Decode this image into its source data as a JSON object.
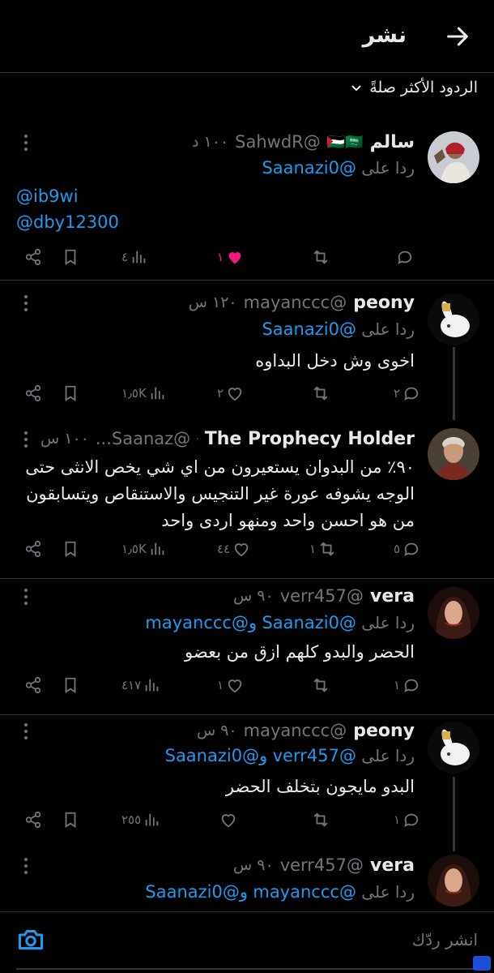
{
  "header": {
    "title": "نشر"
  },
  "sort": {
    "label": "الردود الأكثر صلةً"
  },
  "tweets": [
    {
      "name": "سالم",
      "flags": "🇵🇸🇸🇦",
      "handle": "@SahwdR",
      "time": "١٠٠ د",
      "reply_prefix": "ردا على",
      "reply_to": "@Saanazi0",
      "extra_mentions": [
        "@ib9wi",
        "@dby12300"
      ],
      "text": "",
      "counts": {
        "views": "٤",
        "like": "١",
        "retweet": "",
        "reply": ""
      }
    },
    {
      "name": "peony",
      "handle": "@mayanccc",
      "time": "١٢٠ س",
      "reply_prefix": "ردا على",
      "reply_to": "@Saanazi0",
      "text": "اخوى وش دخل البداوه",
      "counts": {
        "views": "١٫٥K",
        "like": "٢",
        "retweet": "",
        "reply": "٢"
      }
    },
    {
      "name": "The Prophecy Holder",
      "handle": "@Saanaz...",
      "time": "١٠٠ س",
      "text": "٩٠٪ من البدوان يستعيرون من اي شي يخص الانثى حتى الوجه يشوفه عورة غير التنجيس والاستنقاص ويتسابقون من هو احسن واحد ومنهو اردى واحد",
      "counts": {
        "views": "١٫٥K",
        "like": "٤٤",
        "retweet": "١",
        "reply": "٥"
      }
    },
    {
      "name": "vera",
      "handle": "@verr457",
      "time": "٩٠ س",
      "reply_prefix": "ردا على",
      "reply_to": "@Saanazi0",
      "reply_and": "و",
      "reply_to2": "@mayanccc",
      "text": "الحضر والبدو كلهم ازق من بعضو",
      "counts": {
        "views": "٤١٧",
        "like": "١",
        "retweet": "",
        "reply": "١"
      }
    },
    {
      "name": "peony",
      "handle": "@mayanccc",
      "time": "٩٠ س",
      "reply_prefix": "ردا على",
      "reply_to": "@verr457",
      "reply_and": "و",
      "reply_to2": "@Saanazi0",
      "text": "البدو مايجون بتخلف الحضر",
      "counts": {
        "views": "٢٥٥",
        "like": "",
        "retweet": "",
        "reply": "١"
      }
    },
    {
      "name": "vera",
      "handle": "@verr457",
      "time": "٩٠ س",
      "reply_prefix": "ردا على",
      "reply_to": "@mayanccc",
      "reply_and": "و",
      "reply_to2": "@Saanazi0",
      "text": "",
      "counts": {
        "views": "",
        "like": "",
        "retweet": "",
        "reply": ""
      }
    }
  ],
  "composer": {
    "placeholder": "انشر ردّك"
  },
  "colors": {
    "accent": "#1d9bf0",
    "like": "#f91880",
    "muted": "#71767b",
    "verified": "#1d9bf0"
  }
}
